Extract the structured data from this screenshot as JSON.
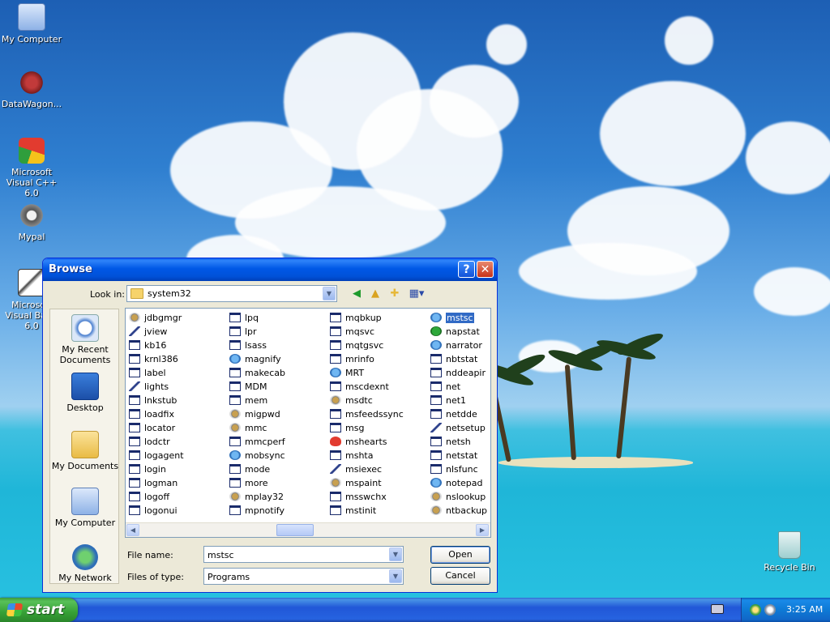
{
  "desktop": {
    "icons": [
      {
        "label": "My Computer"
      },
      {
        "label": "DataWagon..."
      },
      {
        "label": "Microsoft Visual C++ 6.0"
      },
      {
        "label": "Mypal"
      },
      {
        "label": "Microsoft Visual Basic 6.0"
      },
      {
        "label": "Recycle Bin"
      }
    ]
  },
  "dialog": {
    "title": "Browse",
    "help_label": "?",
    "close_label": "✕",
    "look_in_label": "Look in:",
    "look_in_value": "system32",
    "toolbar_icons": [
      "back-icon",
      "up-folder-icon",
      "new-folder-icon",
      "view-menu-icon"
    ],
    "places": [
      {
        "label": "My Recent Documents"
      },
      {
        "label": "Desktop"
      },
      {
        "label": "My Documents"
      },
      {
        "label": "My Computer"
      },
      {
        "label": "My Network"
      }
    ],
    "files": {
      "col1": [
        "jdbgmgr",
        "jview",
        "kb16",
        "krnl386",
        "label",
        "lights",
        "lnkstub",
        "loadfix",
        "locator",
        "lodctr",
        "logagent",
        "login",
        "logman",
        "logoff",
        "logonui"
      ],
      "col2": [
        "lpq",
        "lpr",
        "lsass",
        "magnify",
        "makecab",
        "MDM",
        "mem",
        "migpwd",
        "mmc",
        "mmcperf",
        "mobsync",
        "mode",
        "more",
        "mplay32",
        "mpnotify"
      ],
      "col3": [
        "mqbkup",
        "mqsvc",
        "mqtgsvc",
        "mrinfo",
        "MRT",
        "mscdexnt",
        "msdtc",
        "msfeedssync",
        "msg",
        "mshearts",
        "mshta",
        "msiexec",
        "mspaint",
        "msswchx",
        "mstinit"
      ],
      "col4": [
        "mstsc",
        "napstat",
        "narrator",
        "nbtstat",
        "nddeapir",
        "net",
        "net1",
        "netdde",
        "netsetup",
        "netsh",
        "netstat",
        "nlsfunc",
        "notepad",
        "nslookup",
        "ntbackup"
      ]
    },
    "selected_file": "mstsc",
    "file_name_label": "File name:",
    "file_name_value": "mstsc",
    "file_type_label": "Files of type:",
    "file_type_value": "Programs",
    "open_label": "Open",
    "cancel_label": "Cancel"
  },
  "taskbar": {
    "start_label": "start",
    "clock": "3:25 AM"
  }
}
